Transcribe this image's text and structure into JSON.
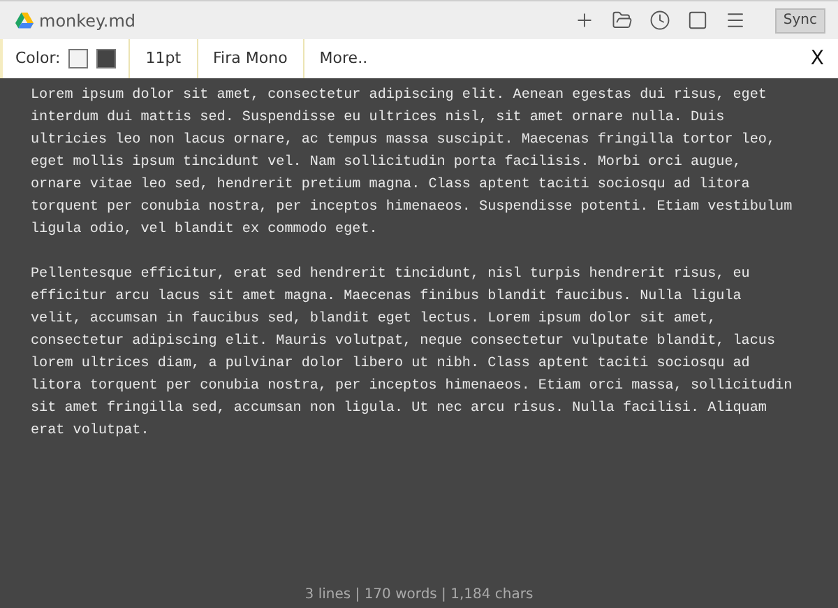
{
  "window": {
    "title": "monkey.md",
    "sync_button": "Sync"
  },
  "toolbar": {
    "color_label": "Color:",
    "swatches": [
      {
        "color": "#f2f2f2"
      },
      {
        "color": "#444444"
      }
    ],
    "font_size": "11pt",
    "font": "Fira Mono",
    "more": "More..",
    "close": "X"
  },
  "editor": {
    "paragraphs": [
      [
        "Lorem ipsum dolor sit amet, consectetur adipiscing elit. Aenean egestas dui risus, eget",
        "interdum dui mattis sed. Suspendisse eu ultrices nisl, sit amet ornare nulla. Duis",
        "ultricies leo non lacus ornare, ac tempus massa suscipit. Maecenas fringilla tortor leo,",
        "eget mollis ipsum tincidunt vel. Nam sollicitudin porta facilisis. Morbi orci augue,",
        "ornare vitae leo sed, hendrerit pretium magna. Class aptent taciti sociosqu ad litora",
        "torquent per conubia nostra, per inceptos himenaeos. Suspendisse potenti. Etiam vestibulum",
        "ligula odio, vel blandit ex commodo eget."
      ],
      [
        "Pellentesque efficitur, erat sed hendrerit tincidunt, nisl turpis hendrerit risus, eu",
        "efficitur arcu lacus sit amet magna. Maecenas finibus blandit faucibus. Nulla ligula",
        "velit, accumsan in faucibus sed, blandit eget lectus. Lorem ipsum dolor sit amet,",
        "consectetur adipiscing elit. Mauris volutpat, neque consectetur vulputate blandit, lacus",
        "lorem ultrices diam, a pulvinar dolor libero ut nibh. Class aptent taciti sociosqu ad",
        "litora torquent per conubia nostra, per inceptos himenaeos. Etiam orci massa, sollicitudin",
        "sit amet fringilla sed, accumsan non ligula. Ut nec arcu risus. Nulla facilisi. Aliquam",
        "erat volutpat."
      ]
    ]
  },
  "status_bar": "3 lines | 170 words | 1,184 chars"
}
